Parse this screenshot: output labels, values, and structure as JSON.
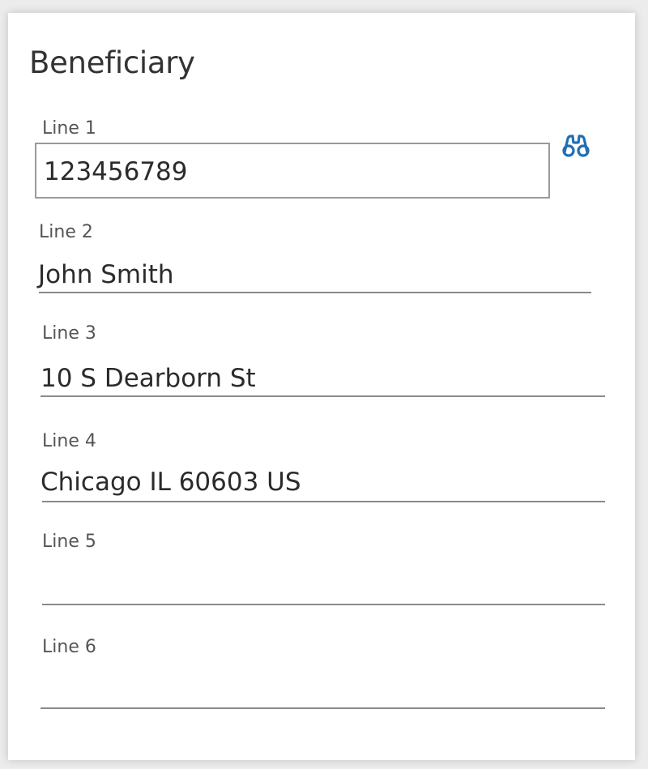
{
  "panel": {
    "title": "Beneficiary"
  },
  "fields": {
    "line1": {
      "label": "Line 1",
      "value": "123456789"
    },
    "line2": {
      "label": "Line 2",
      "value": "John Smith"
    },
    "line3": {
      "label": "Line 3",
      "value": "10 S Dearborn St"
    },
    "line4": {
      "label": "Line 4",
      "value": "Chicago IL 60603 US"
    },
    "line5": {
      "label": "Line 5",
      "value": ""
    },
    "line6": {
      "label": "Line 6",
      "value": ""
    }
  },
  "icons": {
    "lookup": "binoculars-icon"
  },
  "colors": {
    "icon_blue": "#1f6fb5",
    "text": "#2b2b2b",
    "label": "#555555"
  }
}
